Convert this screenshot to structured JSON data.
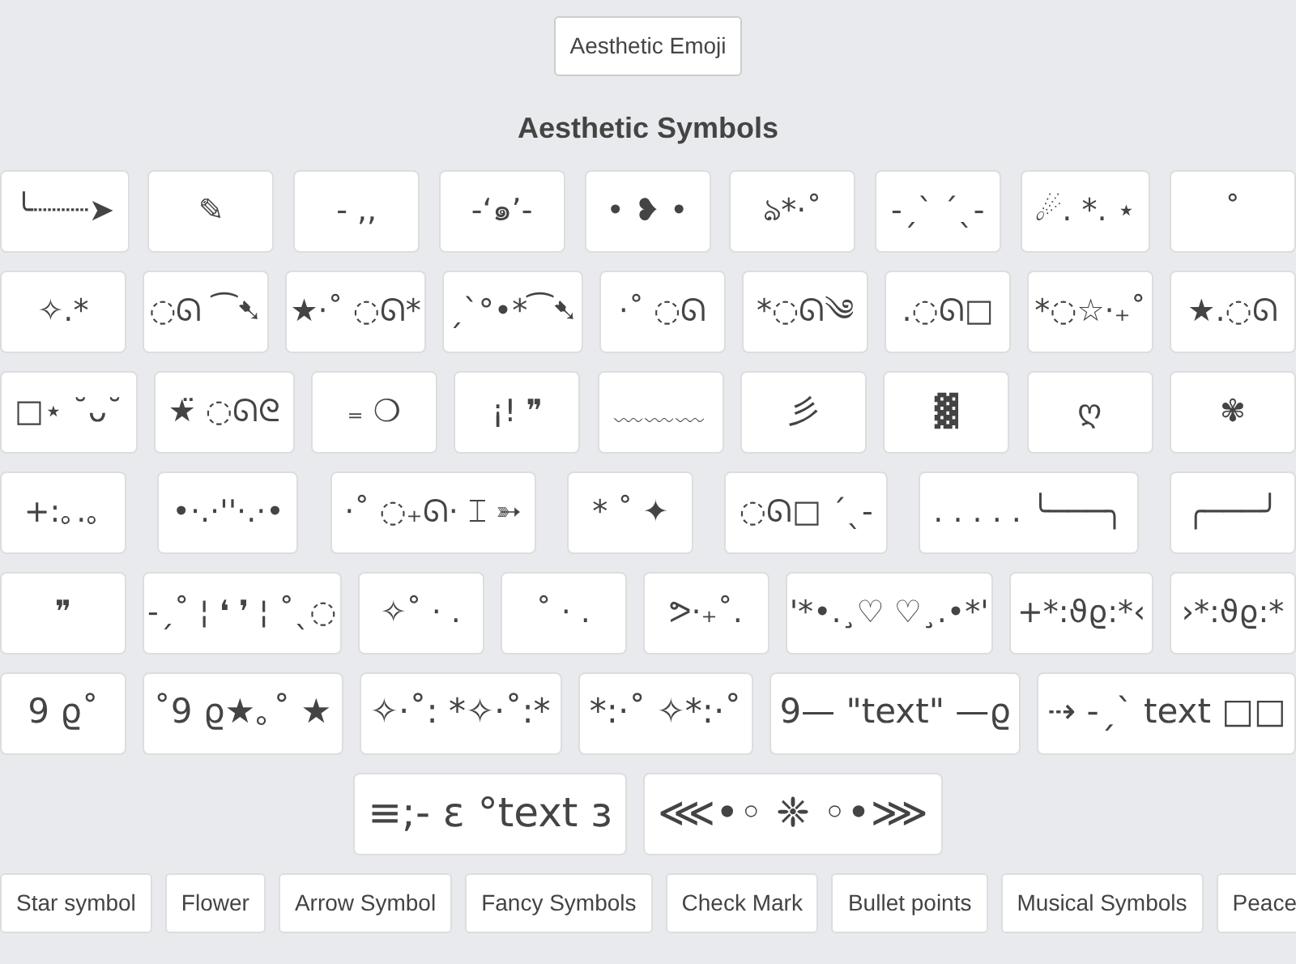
{
  "top_button": "Aesthetic Emoji",
  "heading": "Aesthetic Symbols",
  "rows": [
    {
      "kind": "normal",
      "tiles": [
        "╰┈┈┈➤",
        "✎",
        "- ,,",
        "-‘๑’-",
        "• ❥ •",
        "ঌ*·˚",
        "-ˏˋ ˊˎ-",
        "☄. *. ⋆",
        "˚"
      ]
    },
    {
      "kind": "normal",
      "tiles": [
        "✧.*",
        "◌ᘏ ⁀➷",
        "★·˚ ◌ᘏ*",
        "ˏˋ°•*⁀➷",
        "·˚ ◌ᘏ",
        "*◌ᘏ༄",
        ".◌ᘏ□",
        "*◌☆·₊˚",
        "★.◌ᘏ"
      ]
    },
    {
      "kind": "normal",
      "tiles": [
        "□⋆ ˘ᴗ˘",
        "★̈ ◌ᘏᘓ",
        "₌ ❍",
        "¡! ❞",
        "﹏﹏﹏",
        "彡",
        "▓",
        "ღ",
        "✾"
      ]
    },
    {
      "kind": "normal",
      "tiles": [
        "+:｡.｡",
        "•·.·''·.·•",
        "·˚ ◌₊ᘏ· ⌶ ➳",
        "* ˚ ✦",
        "◌ᘏ□ ˊˎ-",
        ". . . . .  ╰───╮",
        "╭───╯"
      ]
    },
    {
      "kind": "normal",
      "tiles": [
        "❞",
        "-ˏ˚ ¦ ❛ ❜ ¦ ˚ˎ◌",
        "✧˚ · .",
        "˚ · .",
        "ᕗ·₊˚.",
        "'*•.¸♡ ♡¸.•*'",
        "+*:ϑϱ:*‹",
        "›*:ϑϱ:*"
      ]
    },
    {
      "kind": "large",
      "tiles": [
        "9 ϱ˚",
        "˚9 ϱ★｡˚ ★",
        "✧·˚: *✧·˚:*",
        "*:·˚ ✧*:·˚",
        "9— \"text\" —ϱ",
        "⇢ -ˏˋ text □□"
      ]
    },
    {
      "kind": "huge",
      "tiles": [
        "≡;- ɛ °text ɜ",
        "⋘•◦ ❈ ◦•⋙"
      ]
    }
  ],
  "nav": [
    "Star symbol",
    "Flower",
    "Arrow Symbol",
    "Fancy Symbols",
    "Check Mark",
    "Bullet points",
    "Musical Symbols",
    "Peace"
  ]
}
